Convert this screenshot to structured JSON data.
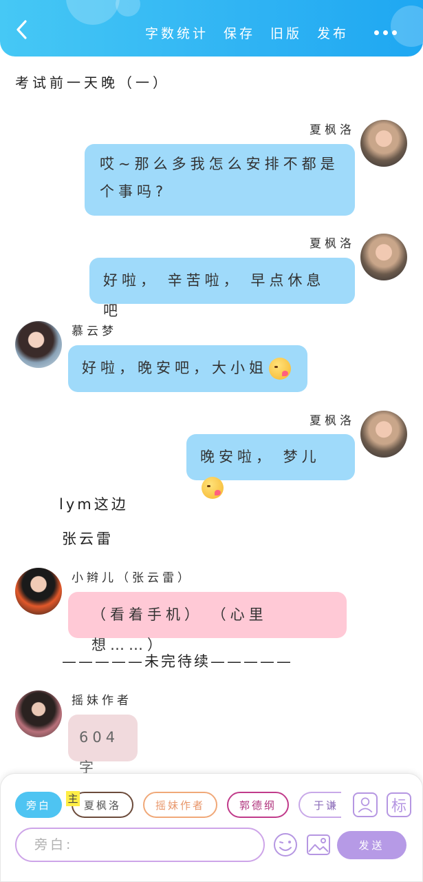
{
  "header": {
    "actions": [
      "字数统计",
      "保存",
      "旧版",
      "发布"
    ],
    "back_icon": "chevron-left-icon",
    "more_icon": "more-dots-icon",
    "colors": {
      "start": "#46c8f5",
      "end": "#1ea7f2"
    }
  },
  "chapter_title": "考试前一天晚（一）",
  "messages": [
    {
      "speaker": "夏枫洛",
      "side": "right",
      "lines": [
        "哎~那么多我怎么安排不都是",
        "个事吗?"
      ],
      "color": "#9fdafa"
    },
    {
      "speaker": "夏枫洛",
      "side": "right",
      "text": "好啦，  辛苦啦，  早点休息吧",
      "color": "#9fdafa"
    },
    {
      "speaker": "慕云梦",
      "side": "left",
      "text": "好啦，晚安吧，大小姐",
      "color": "#9fdafa"
    },
    {
      "speaker": "夏枫洛",
      "side": "right",
      "text": "晚安啦，  梦儿",
      "color": "#9fdafa"
    }
  ],
  "narrations": [
    "lym这边",
    "张云雷"
  ],
  "pink_message": {
    "speaker": "小辫儿（张云雷）",
    "text": "（看着手机）  （心里想……）",
    "color": "#ffc9d6"
  },
  "divider": "—————未完待续—————",
  "author_message": {
    "speaker": "摇妹作者",
    "text": "604字"
  },
  "toolbar": {
    "chips": [
      "旁白",
      "夏枫洛",
      "摇妹作者",
      "郭德纲",
      "于谦"
    ],
    "main_tag": "主",
    "input_placeholder": "旁白:",
    "send_label": "发送",
    "label_icon_text": "标",
    "accent": "#b69ae6"
  }
}
